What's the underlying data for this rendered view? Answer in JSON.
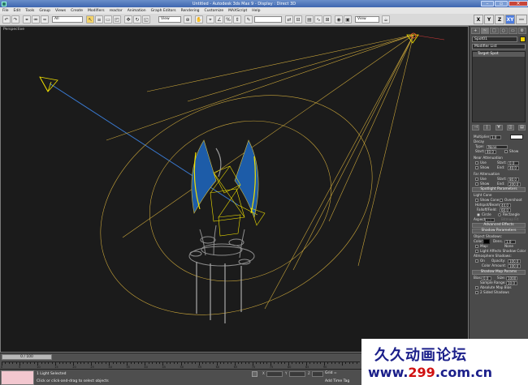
{
  "titlebar": {
    "title": "Untitled - Autodesk 3ds Max 9 - Display : Direct 3D"
  },
  "menubar": {
    "items": [
      "File",
      "Edit",
      "Tools",
      "Group",
      "Views",
      "Create",
      "Modifiers",
      "reactor",
      "Animation",
      "Graph Editors",
      "Rendering",
      "Customize",
      "MAXScript",
      "Help"
    ]
  },
  "toolbar": {
    "selection_filter": "All",
    "ref_coord": "View",
    "named_sel": "",
    "axis": [
      "X",
      "Y",
      "Z",
      "XY"
    ],
    "active_axis": "XY"
  },
  "viewport": {
    "label": "Perspective"
  },
  "command_panel": {
    "tabs": [
      "+",
      "~",
      "□",
      "○",
      "▭",
      "⚙"
    ],
    "object_name": "Spot01",
    "object_color": "#f0d000",
    "modifier_list": "Modifier List",
    "stack_item": "Target Spot",
    "stack_tools": [
      "⊣",
      "|",
      "∀",
      "◫",
      "▤"
    ],
    "general": {
      "multiplier_label": "Multiplier:",
      "multiplier": "1.0",
      "decay_label": "Decay",
      "type_label": "Type:",
      "type_value": "None",
      "start_label": "Start:",
      "start_value": "40.0",
      "show_label": "Show"
    },
    "near_atten": {
      "header": "Near Attenuation",
      "use": "Use",
      "show": "Show",
      "start_label": "Start:",
      "start": "0.0",
      "end_label": "End:",
      "end": "40.0"
    },
    "far_atten": {
      "header": "Far Attenuation",
      "use": "Use",
      "show": "Show",
      "start_label": "Start:",
      "start": "80.0",
      "end_label": "End:",
      "end": "200.0"
    },
    "spotlight": {
      "header": "Spotlight Parameters",
      "light_cone": "Light Cone",
      "show_cone": "Show Cone",
      "overshoot": "Overshoot",
      "hotspot_label": "Hotspot/Beam:",
      "hotspot": "44.0",
      "falloff_label": "Falloff/Field:",
      "falloff": "60.0",
      "circle": "Circle",
      "rectangle": "Rectangle",
      "aspect_label": "Aspect:",
      "aspect": "1.0",
      "bitmap_fit": "Bitmap Fit"
    },
    "advanced": {
      "header": "Advanced Effects"
    },
    "shadow_params": {
      "header": "Shadow Parameters",
      "object_shadows": "Object Shadows:",
      "color_label": "Color:",
      "dens_label": "Dens.",
      "dens": "1.0",
      "map_label": "Map:",
      "map_value": "None",
      "light_affects": "Light Affects Shadow Color",
      "atmo_header": "Atmosphere Shadows:",
      "on_label": "On",
      "opacity_label": "Opacity:",
      "opacity": "100.0",
      "color_amount_label": "Color Amount:",
      "color_amount": "100.0"
    },
    "shadow_map": {
      "header": "Shadow Map Params",
      "bias_label": "Bias:",
      "bias": "0.0",
      "size_label": "Size:",
      "size": "1000",
      "sample_range_label": "Sample Range:",
      "sample_range": "10.0",
      "absolute_bias": "Absolute Map Bias",
      "two_sided": "2 Sided Shadows"
    }
  },
  "timeline": {
    "slider": "0 / 100",
    "ticks": [
      "0",
      "5",
      "10",
      "15",
      "20",
      "25",
      "30",
      "35",
      "40",
      "45",
      "50",
      "55",
      "60",
      "65",
      "70",
      "75",
      "80",
      "85",
      "90"
    ]
  },
  "status": {
    "line1": "1 Light Selected",
    "line2": "Click or click-and-drag to select objects",
    "x_label": "X",
    "x_value": "",
    "y_label": "Y",
    "y_value": "",
    "z_label": "Z",
    "z_value": "",
    "grid_label": "Grid =",
    "add_time_tag": "Add Time Tag"
  },
  "watermark": {
    "cn_text": "久久动画论坛",
    "url_prefix": "www.",
    "url_accent": "299",
    "url_suffix": ".com.cn"
  }
}
